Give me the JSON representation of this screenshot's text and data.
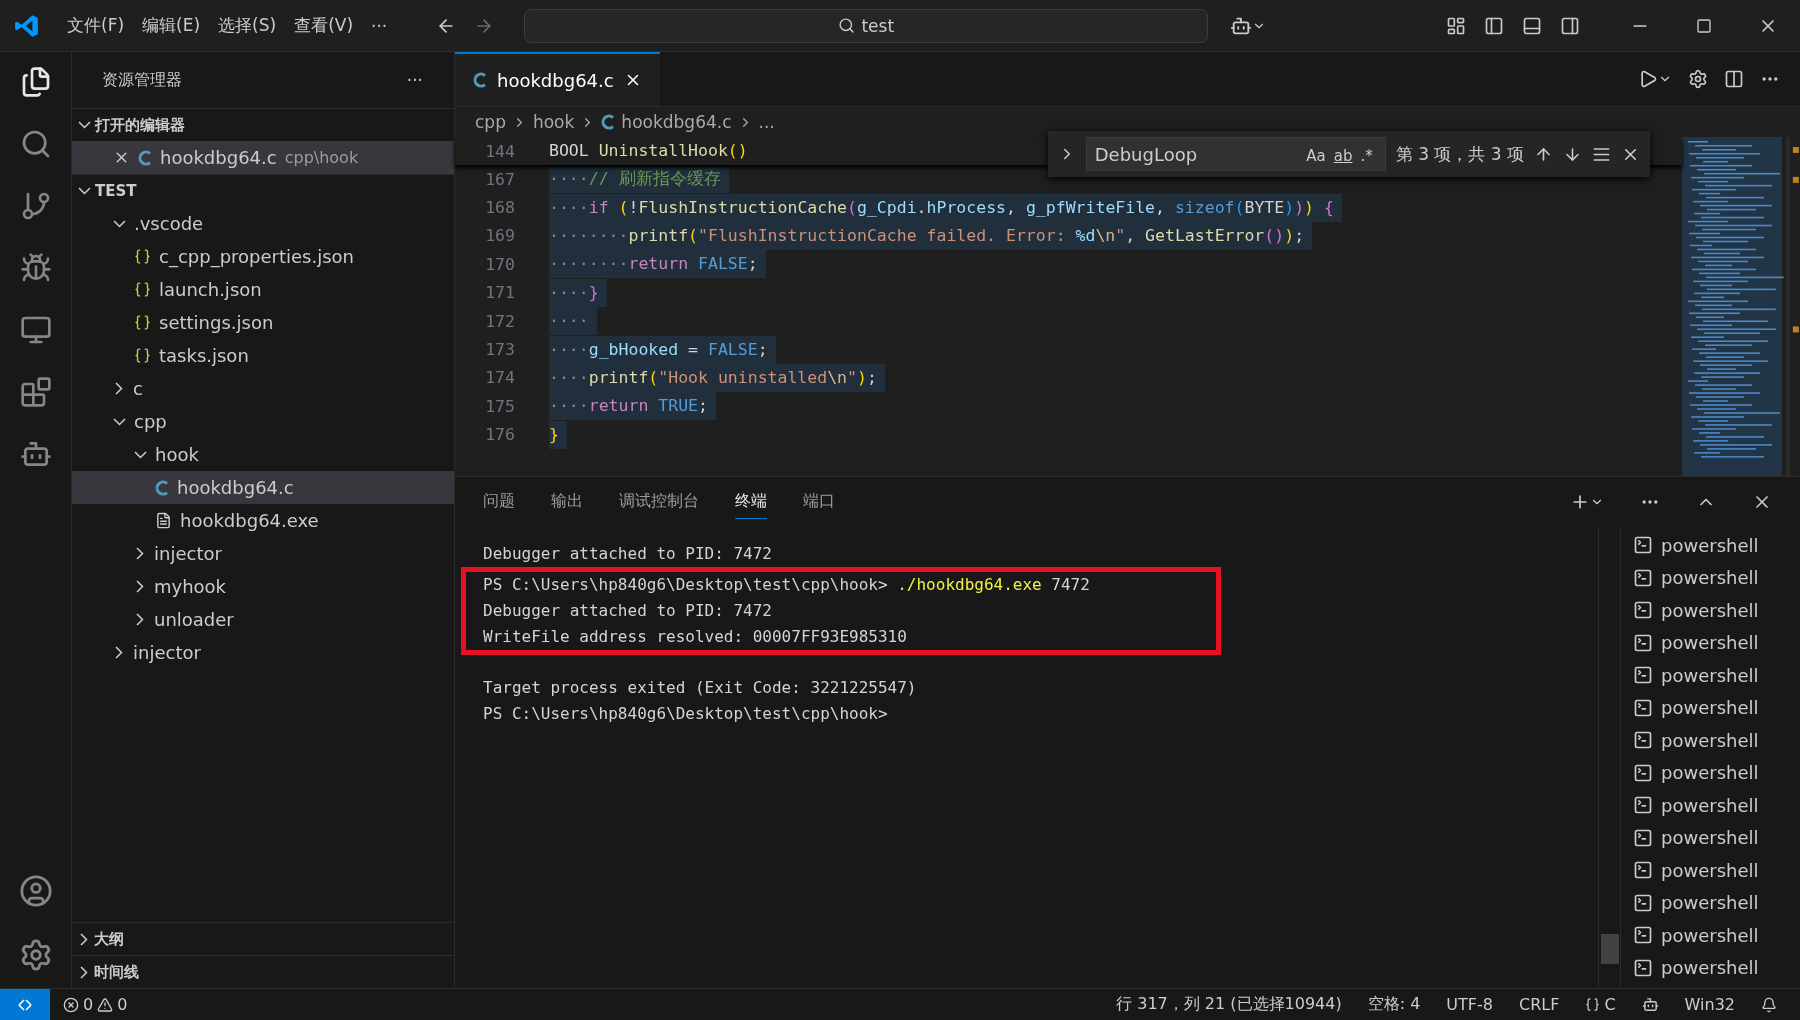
{
  "menu": [
    "文件(F)",
    "编辑(E)",
    "选择(S)",
    "查看(V)",
    "···"
  ],
  "command_center": {
    "value": "test"
  },
  "sidebar": {
    "title": "资源管理器",
    "more": "···",
    "open_editors": {
      "title": "打开的编辑器",
      "expanded": true,
      "items": [
        {
          "name": "hookdbg64.c",
          "path": "cpp\\hook",
          "selected": true
        }
      ]
    },
    "workspace": {
      "title": "TEST",
      "expanded": true,
      "tree": [
        {
          "name": ".vscode",
          "kind": "folder",
          "expanded": true,
          "selected": false,
          "children": [
            {
              "name": "c_cpp_properties.json",
              "kind": "json",
              "selected": false
            },
            {
              "name": "launch.json",
              "kind": "json",
              "selected": false
            },
            {
              "name": "settings.json",
              "kind": "json",
              "selected": false
            },
            {
              "name": "tasks.json",
              "kind": "json",
              "selected": false
            }
          ]
        },
        {
          "name": "c",
          "kind": "folder",
          "expanded": false,
          "selected": false
        },
        {
          "name": "cpp",
          "kind": "folder",
          "expanded": true,
          "selected": false,
          "children": [
            {
              "name": "hook",
              "kind": "folder",
              "expanded": true,
              "selected": false,
              "children": [
                {
                  "name": "hookdbg64.c",
                  "kind": "c",
                  "selected": true
                },
                {
                  "name": "hookdbg64.exe",
                  "kind": "file",
                  "selected": false
                }
              ]
            },
            {
              "name": "injector",
              "kind": "folder",
              "expanded": false,
              "selected": false
            },
            {
              "name": "myhook",
              "kind": "folder",
              "expanded": false,
              "selected": false
            },
            {
              "name": "unloader",
              "kind": "folder",
              "expanded": false,
              "selected": false
            }
          ]
        },
        {
          "name": "injector",
          "kind": "folder",
          "expanded": false,
          "selected": false
        }
      ]
    },
    "bottom_sections": [
      {
        "title": "大纲",
        "expanded": false
      },
      {
        "title": "时间线",
        "expanded": false
      }
    ]
  },
  "editor": {
    "tabs": [
      {
        "name": "hookdbg64.c",
        "selected": true
      }
    ],
    "breadcrumb": [
      "cpp",
      "hook",
      "hookdbg64.c",
      "..."
    ],
    "sticky_line": {
      "number": "144",
      "tokens": [
        {
          "text": "BOOL ",
          "kind": "plain"
        },
        {
          "text": "UninstallHook",
          "kind": "fn"
        },
        {
          "text": "()",
          "kind": "b1"
        }
      ]
    },
    "lines": [
      {
        "number": "167",
        "selected": true,
        "tokens": [
          {
            "text": "····",
            "kind": "ws"
          },
          {
            "text": "// 刷新指令缓存",
            "kind": "comment"
          }
        ]
      },
      {
        "number": "168",
        "selected": true,
        "tokens": [
          {
            "text": "····",
            "kind": "ws"
          },
          {
            "text": "if ",
            "kind": "control"
          },
          {
            "text": "(",
            "kind": "b1"
          },
          {
            "text": "!",
            "kind": "plain"
          },
          {
            "text": "FlushInstructionCache",
            "kind": "fn"
          },
          {
            "text": "(",
            "kind": "b2"
          },
          {
            "text": "g_Cpdi",
            "kind": "var"
          },
          {
            "text": ".",
            "kind": "plain"
          },
          {
            "text": "hProcess",
            "kind": "var"
          },
          {
            "text": ", ",
            "kind": "plain"
          },
          {
            "text": "g_pfWriteFile",
            "kind": "var"
          },
          {
            "text": ", ",
            "kind": "plain"
          },
          {
            "text": "sizeof",
            "kind": "kw"
          },
          {
            "text": "(",
            "kind": "b3"
          },
          {
            "text": "BYTE",
            "kind": "plain"
          },
          {
            "text": ")",
            "kind": "b3"
          },
          {
            "text": ")",
            "kind": "b2"
          },
          {
            "text": ") ",
            "kind": "b1"
          },
          {
            "text": "{",
            "kind": "b2"
          }
        ]
      },
      {
        "number": "169",
        "selected": true,
        "tokens": [
          {
            "text": "········",
            "kind": "ws"
          },
          {
            "text": "printf",
            "kind": "fn"
          },
          {
            "text": "(",
            "kind": "b1"
          },
          {
            "text": "\"FlushInstructionCache failed. Error: ",
            "kind": "string"
          },
          {
            "text": "%d",
            "kind": "var"
          },
          {
            "text": "\\n",
            "kind": "escape"
          },
          {
            "text": "\"",
            "kind": "string"
          },
          {
            "text": ", ",
            "kind": "plain"
          },
          {
            "text": "GetLastError",
            "kind": "fn"
          },
          {
            "text": "()",
            "kind": "b2"
          },
          {
            "text": ")",
            "kind": "b1"
          },
          {
            "text": ";",
            "kind": "plain"
          }
        ]
      },
      {
        "number": "170",
        "selected": true,
        "tokens": [
          {
            "text": "········",
            "kind": "ws"
          },
          {
            "text": "return ",
            "kind": "control"
          },
          {
            "text": "FALSE",
            "kind": "kw"
          },
          {
            "text": ";",
            "kind": "plain"
          }
        ]
      },
      {
        "number": "171",
        "selected": true,
        "tokens": [
          {
            "text": "····",
            "kind": "ws"
          },
          {
            "text": "}",
            "kind": "b2"
          }
        ]
      },
      {
        "number": "172",
        "selected": true,
        "tokens": [
          {
            "text": "····",
            "kind": "ws"
          }
        ]
      },
      {
        "number": "173",
        "selected": true,
        "tokens": [
          {
            "text": "····",
            "kind": "ws"
          },
          {
            "text": "g_bHooked",
            "kind": "var"
          },
          {
            "text": " = ",
            "kind": "plain"
          },
          {
            "text": "FALSE",
            "kind": "kw"
          },
          {
            "text": ";",
            "kind": "plain"
          }
        ]
      },
      {
        "number": "174",
        "selected": true,
        "tokens": [
          {
            "text": "····",
            "kind": "ws"
          },
          {
            "text": "printf",
            "kind": "fn"
          },
          {
            "text": "(",
            "kind": "b1"
          },
          {
            "text": "\"Hook uninstalled",
            "kind": "string"
          },
          {
            "text": "\\n",
            "kind": "escape"
          },
          {
            "text": "\"",
            "kind": "string"
          },
          {
            "text": ")",
            "kind": "b1"
          },
          {
            "text": ";",
            "kind": "plain"
          }
        ]
      },
      {
        "number": "175",
        "selected": true,
        "tokens": [
          {
            "text": "····",
            "kind": "ws"
          },
          {
            "text": "return ",
            "kind": "control"
          },
          {
            "text": "TRUE",
            "kind": "kw"
          },
          {
            "text": ";",
            "kind": "plain"
          }
        ]
      },
      {
        "number": "176",
        "selected": true,
        "tokens": [
          {
            "text": "}",
            "kind": "b1"
          }
        ]
      }
    ],
    "find": {
      "value": "DebugLoop",
      "options": [
        "Aa",
        "ab",
        ".*"
      ],
      "result": "第 3 项，共 3 项"
    }
  },
  "panel": {
    "tabs": [
      {
        "label": "问题",
        "selected": false
      },
      {
        "label": "输出",
        "selected": false
      },
      {
        "label": "调试控制台",
        "selected": false
      },
      {
        "label": "终端",
        "selected": true
      },
      {
        "label": "端口",
        "selected": false
      }
    ],
    "terminal": [
      {
        "highlighted": false,
        "tokens": [
          {
            "text": "Debugger attached to PID: 7472",
            "kind": "plain"
          }
        ]
      },
      {
        "highlighted": true,
        "tokens": [
          {
            "text": "PS C:\\Users\\hp840g6\\Desktop\\test\\cpp\\hook> ",
            "kind": "plain"
          },
          {
            "text": "./hookdbg64.exe",
            "kind": "command"
          },
          {
            "text": " 7472",
            "kind": "plain"
          }
        ]
      },
      {
        "highlighted": true,
        "tokens": [
          {
            "text": "Debugger attached to PID: 7472",
            "kind": "plain"
          }
        ]
      },
      {
        "highlighted": true,
        "tokens": [
          {
            "text": "WriteFile address resolved: 00007FF93E985310",
            "kind": "plain"
          }
        ]
      },
      {
        "highlighted": false,
        "gap_before": true,
        "tokens": [
          {
            "text": "Target process exited (Exit Code: 3221225547)",
            "kind": "plain"
          }
        ]
      },
      {
        "highlighted": false,
        "tokens": [
          {
            "text": "PS C:\\Users\\hp840g6\\Desktop\\test\\cpp\\hook>",
            "kind": "plain"
          }
        ]
      }
    ],
    "shells": [
      "powershell",
      "powershell",
      "powershell",
      "powershell",
      "powershell",
      "powershell",
      "powershell",
      "powershell",
      "powershell",
      "powershell",
      "powershell",
      "powershell",
      "powershell",
      "powershell"
    ]
  },
  "status_bar": {
    "errors": "0",
    "warnings": "0",
    "position": "行 317，列 21 (已选择10944)",
    "indent": "空格: 4",
    "encoding": "UTF-8",
    "eol": "CRLF",
    "language": "C",
    "platform": "Win32"
  }
}
